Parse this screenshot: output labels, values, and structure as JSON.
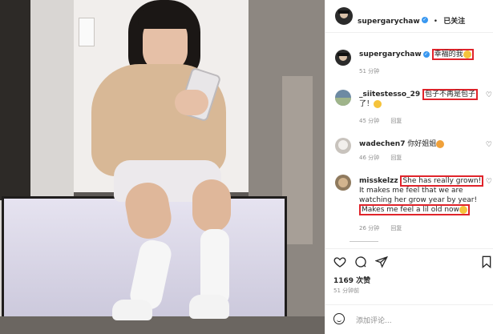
{
  "post": {
    "username": "supergarychaw",
    "dot": "•",
    "follow_state": "已关注",
    "comments": [
      {
        "user": "supergarychaw",
        "text_highlight": "幸福的我",
        "time": "51 分钟"
      },
      {
        "user": "_siitestesso_29",
        "text_highlight": "包子不再是包子",
        "text_rest": "了！",
        "time": "45 分钟",
        "reply": "回复"
      },
      {
        "user": "wadechen7",
        "text": "你好姐姐",
        "time": "46 分钟",
        "reply": "回复"
      },
      {
        "user": "misskelzz",
        "text_highlight_1": "She has really grown!",
        "text_middle": "It makes me feel that we are watching her grow year by year!",
        "text_highlight_2": "Makes me feel a lil old now",
        "time": "26 分钟",
        "reply": "回复"
      }
    ],
    "likes": "1169 次赞",
    "posted": "51 分钟前",
    "comment_placeholder": "添加评论..."
  },
  "icons": {
    "like": "heart-icon",
    "comment": "comment-icon",
    "share": "send-icon",
    "save": "bookmark-icon",
    "emoji": "smile-icon",
    "verified": "verified-badge-icon"
  },
  "colors": {
    "highlight_box": "#e0242b",
    "verified_blue": "#3897f0",
    "muted_text": "#8e8e8e"
  }
}
